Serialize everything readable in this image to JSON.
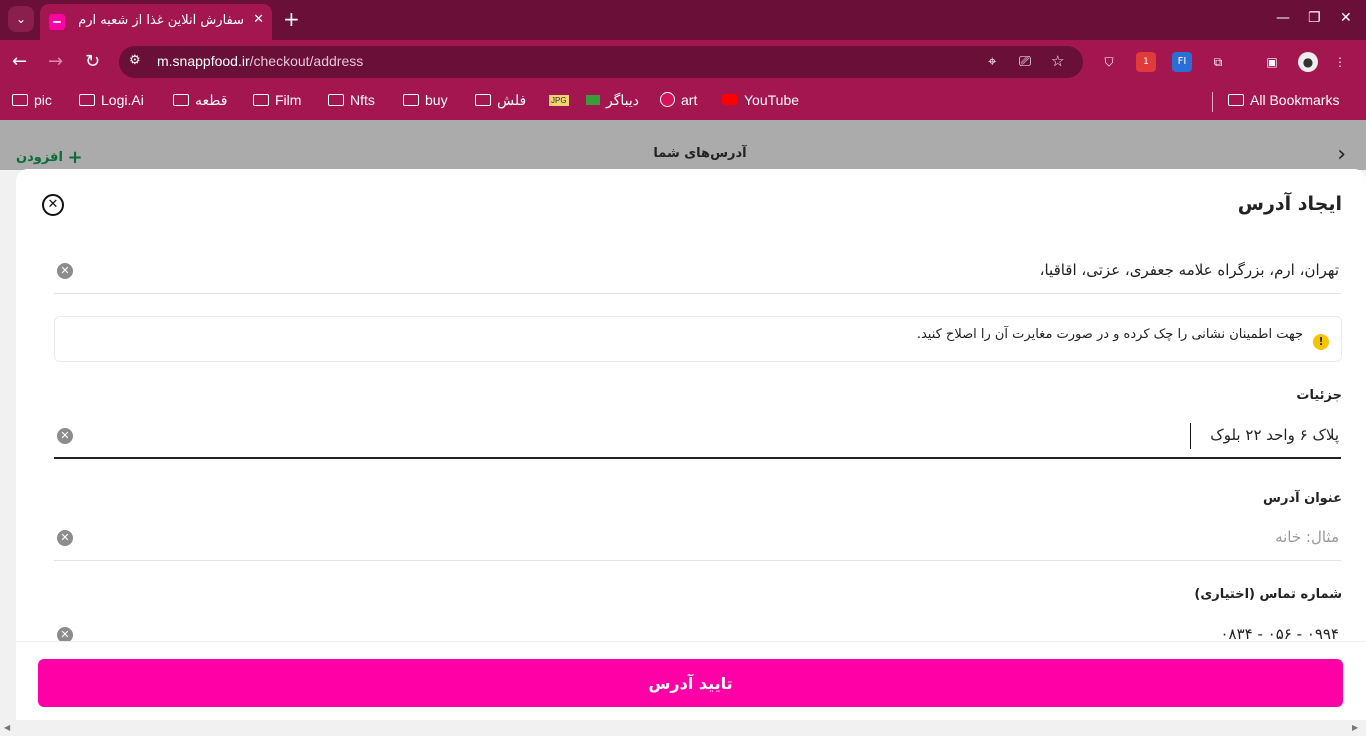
{
  "browser": {
    "tab_title": "سفارش آنلاین غذا از شعبه ارم",
    "url_domain": "m.snappfood.ir",
    "url_path": "/checkout/address",
    "extension_badge": "1",
    "extension_fi": "FI"
  },
  "bookmarks": {
    "items": [
      "pic",
      "Logi.Ai",
      "قطعه",
      "Film",
      "Nfts",
      "buy",
      "فلش",
      "دیباگر",
      "art",
      "YouTube"
    ],
    "all": "All Bookmarks"
  },
  "header": {
    "title": "آدرس‌های شما",
    "add_label": "افزودن"
  },
  "modal": {
    "title": "ایجاد آدرس",
    "address_value": "تهران، ارم، بزرگراه علامه جعفری، عزتی، اقاقیا،",
    "notice_text": "جهت اطمینان نشانی را چک کرده و در صورت مغایرت آن را اصلاح کنید.",
    "details_label": "جزئیات",
    "details_value": "پلاک ۶ واحد ۲۲ بلوک",
    "title_label": "عنوان آدرس",
    "title_placeholder": "مثال: خانه",
    "phone_label": "شماره تماس (اختیاری)",
    "phone_value": "۰۹۹۴ - ۰۵۶ - ۰۸۳۴"
  },
  "footer": {
    "confirm_label": "تایید آدرس"
  },
  "colors": {
    "accent": "#ff00a6",
    "browser_frame": "#a3164f",
    "add_link": "#0e6b3a"
  }
}
